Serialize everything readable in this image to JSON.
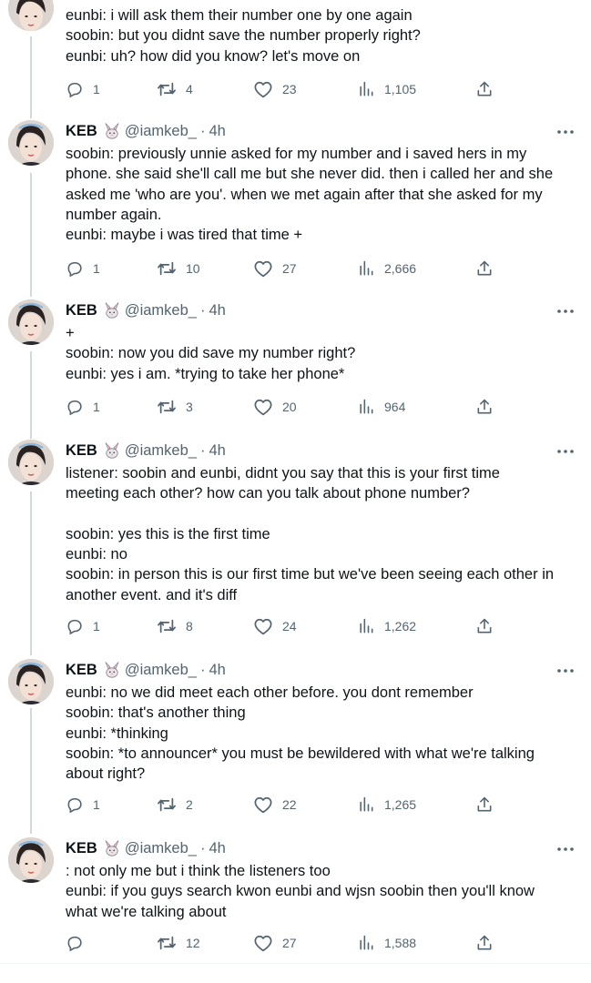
{
  "first_tweet": {
    "lines": "eunbi: i will ask them their number one by one again\nsoobin: but you didnt save the number properly right?\neunbi: uh? how did you know? let's move on",
    "replies": "1",
    "retweets": "4",
    "likes": "23",
    "views": "1,105"
  },
  "tweets": [
    {
      "name": "KEB",
      "handle": "@iamkeb_",
      "dot": "·",
      "time": "4h",
      "text": "soobin: previously unnie asked for my number and i saved hers in my\nphone. she said she'll call me but she never did. then i called her and she\nasked me 'who are you'. when we met again after that she asked for my\nnumber again.\neunbi: maybe i was tired that time +",
      "replies": "1",
      "retweets": "10",
      "likes": "27",
      "views": "2,666"
    },
    {
      "name": "KEB",
      "handle": "@iamkeb_",
      "dot": "·",
      "time": "4h",
      "text": "+\nsoobin: now you did save my number right?\neunbi: yes i am. *trying to take her phone*",
      "replies": "1",
      "retweets": "3",
      "likes": "20",
      "views": "964"
    },
    {
      "name": "KEB",
      "handle": "@iamkeb_",
      "dot": "·",
      "time": "4h",
      "text": "listener: soobin and eunbi, didnt you say that this is your first time\nmeeting each other? how can you talk about phone number?\n\nsoobin: yes this is the first time\neunbi: no\nsoobin: in person this is our first time but we've been seeing each other in\nanother event. and it's diff",
      "replies": "1",
      "retweets": "8",
      "likes": "24",
      "views": "1,262"
    },
    {
      "name": "KEB",
      "handle": "@iamkeb_",
      "dot": "·",
      "time": "4h",
      "text": "eunbi: no we did meet each other before. you dont remember\nsoobin: that's another thing\neunbi: *thinking\nsoobin: *to announcer* you must be bewildered with what we're talking\nabout right?",
      "replies": "1",
      "retweets": "2",
      "likes": "22",
      "views": "1,265"
    },
    {
      "name": "KEB",
      "handle": "@iamkeb_",
      "dot": "·",
      "time": "4h",
      "text": ": not only me but i think the listeners too\neunbi: if you guys search kwon eunbi and wjsn soobin then you'll know\nwhat we're talking about",
      "replies": "",
      "retweets": "12",
      "likes": "27",
      "views": "1,588"
    }
  ],
  "icons": {
    "reply": "reply-icon",
    "retweet": "retweet-icon",
    "like": "heart-icon",
    "views": "views-icon",
    "share": "share-icon",
    "more": "more-icon",
    "badge": "rabbit-emoji-icon"
  },
  "colors": {
    "text": "#0f1419",
    "secondary": "#536471",
    "thread_line": "#cfd9de",
    "divider": "#eff3f4"
  }
}
